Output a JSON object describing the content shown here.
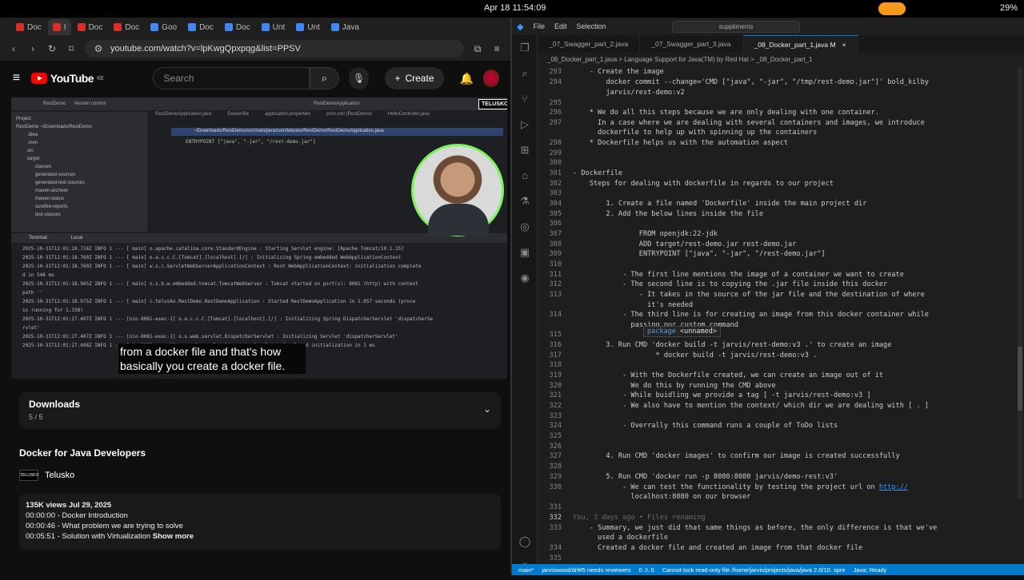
{
  "system": {
    "time": "Apr 18  11:54:09",
    "battery": "29%"
  },
  "browser": {
    "tabs": [
      {
        "label": "Doc",
        "color": "#d93025"
      },
      {
        "label": "I",
        "color": "#d93025"
      },
      {
        "label": "Doc",
        "color": "#d93025"
      },
      {
        "label": "Doc",
        "color": "#d93025"
      },
      {
        "label": "Goo",
        "color": "#4285f4"
      },
      {
        "label": "Doc",
        "color": "#4285f4"
      },
      {
        "label": "Doc",
        "color": "#4285f4"
      },
      {
        "label": "Unt",
        "color": "#4285f4"
      },
      {
        "label": "Unt",
        "color": "#4285f4"
      },
      {
        "label": "Java",
        "color": "#4285f4"
      }
    ],
    "url": "youtube.com/watch?v=lpKwgQpxpqg&list=PPSV"
  },
  "youtube": {
    "logo": "YouTube",
    "country": "KE",
    "search_placeholder": "Search",
    "create": "Create",
    "downloads_title": "Downloads",
    "downloads_count": "5 / 5",
    "video_title": "Docker for Java Developers",
    "channel": "Telusko",
    "channel_logo": "TELUSKO",
    "meta": "135K views  Jul 29, 2025",
    "chapters": [
      {
        "t": "00:00:00",
        "d": "Docker Introduction"
      },
      {
        "t": "00:00:46",
        "d": "What problem we are trying to solve"
      },
      {
        "t": "00:05:51",
        "d": "Solution with Virtualization"
      }
    ],
    "show_more": "Show more",
    "caption_1": "from a docker file and that's how",
    "caption_2": "basically you create a docker file.",
    "badge": "TELUSKO"
  },
  "video_ide": {
    "project": "RestDemo",
    "vcs": "Version control",
    "run_config": "RestDemoApplication",
    "tabs": [
      "RestDemoApplication.java",
      "Dockerfile",
      "application.properties",
      "pom.xml (RestDemo)",
      "HelloController.java"
    ],
    "tree": [
      "Project",
      "RestDemo ~/Downloads/RestDemo",
      ".idea",
      ".mvn",
      "src",
      "target",
      "classes",
      "generated-sources",
      "generated-test-sources",
      "maven-archiver",
      "maven-status",
      "surefire-reports",
      "test-classes"
    ],
    "path_hint": "~/Downloads/RestDemo/src/main/java/com/telusko/RestDemo/RestDemoApplication.java",
    "entrypoint": "ENTRYPOINT [\"java\", \"-jar\", \"/rest-demo.jar\"]",
    "terminal_tabs": [
      "Terminal",
      "Local"
    ],
    "log": [
      "2025-10-31T12:01:18.718Z  INFO 1 --- [   main] o.apache.catalina.core.StandardEngine   : Starting Servlet engine: [Apache Tomcat/10.1.15]",
      "2025-10-31T12:01:18.760Z  INFO 1 --- [   main] o.a.c.c.C.[Tomcat].[localhost].[/]      : Initializing Spring embedded WebApplicationContext",
      "2025-10-31T12:01:18.760Z  INFO 1 --- [   main] w.s.c.ServletWebServerApplicationContext : Root WebApplicationContext: initialization complete",
      "d in 548 ms",
      "2025-10-31T12:01:18.965Z  INFO 1 --- [   main] o.s.b.w.embedded.tomcat.TomcatWebServer  : Tomcat started on port(s): 8081 (http) with context",
      " path ''",
      "2025-10-31T12:01:18.975Z  INFO 1 --- [   main] c.telusko.RestDemo.RestDemoApplication   : Started RestDemoApplication in 1.057 seconds (proce",
      "ss running for 1.338)",
      "2025-10-31T12:01:27.407Z  INFO 1 --- [nio-8081-exec-1] o.a.c.c.C.[Tomcat].[localhost].[/]  : Initializing Spring DispatcherServlet 'dispatcherSe",
      "rvlet'",
      "2025-10-31T12:01:27.407Z  INFO 1 --- [nio-8081-exec-1] o.s.web.servlet.DispatcherServlet   : Initializing Servlet 'dispatcherServlet'",
      "2025-10-31T12:01:27.408Z  INFO 1 --- [nio-8081-exec-1] o.s.web.servlet.DispatcherServlet   : Completed initialization in 1 ms"
    ]
  },
  "vscode": {
    "menu": [
      "File",
      "Edit",
      "Selection"
    ],
    "search": "suppliments",
    "tabs": [
      {
        "label": "_07_Swagger_part_2.java",
        "active": false
      },
      {
        "label": "_07_Swagger_part_3.java",
        "active": false
      },
      {
        "label": "_08_Docker_part_1.java M",
        "active": true
      }
    ],
    "breadcrumb": "_08_Docker_part_1.java  >  Language Support for Java(TM) by Red Hat  >  _08_Docker_part_1",
    "hover": {
      "kw": "package",
      "name": "<unnamed>"
    },
    "status": [
      "main*",
      "jarviswood/drf#5 needs reviewers",
      "0 ⚠ 0",
      "Cannot lock read-only file /home/jarvis/projects/java/java 2.0/10. sprir",
      "Java: Ready"
    ],
    "lines": [
      {
        "n": "293",
        "t": "    - Create the image"
      },
      {
        "n": "294",
        "t": "        docker commit --change='CMD [\"java\", \"-jar\", \"/tmp/rest-demo.jar\"]' bold_kilby"
      },
      {
        "n": "",
        "t": "        jarvis/rest-demo:v2"
      },
      {
        "n": "295",
        "t": ""
      },
      {
        "n": "296",
        "t": "    * We do all this steps because we are only dealing with one container."
      },
      {
        "n": "297",
        "t": "      In a case where we are dealing with several containers and images, we introduce"
      },
      {
        "n": "",
        "t": "      dockerfile to help up with spinning up the containers"
      },
      {
        "n": "298",
        "t": "    * Dockerfile helps us with the automation aspect"
      },
      {
        "n": "299",
        "t": ""
      },
      {
        "n": "300",
        "t": ""
      },
      {
        "n": "301",
        "t": "- Dockerfile"
      },
      {
        "n": "302",
        "t": "    Steps for dealing with dockerfile in regards to our project"
      },
      {
        "n": "303",
        "t": ""
      },
      {
        "n": "304",
        "t": "        1. Create a file named 'Dockerfile' inside the main project dir"
      },
      {
        "n": "305",
        "t": "        2. Add the below lines inside the file"
      },
      {
        "n": "306",
        "t": ""
      },
      {
        "n": "307",
        "t": "                FROM openjdk:22-jdk"
      },
      {
        "n": "308",
        "t": "                ADD target/rest-demo.jar rest-demo.jar"
      },
      {
        "n": "309",
        "t": "                ENTRYPOINT [\"java\", \"-jar\", \"/rest-demo.jar\"]"
      },
      {
        "n": "310",
        "t": ""
      },
      {
        "n": "311",
        "t": "            - The first line mentions the image of a container we want to create"
      },
      {
        "n": "312",
        "t": "            - The second line is to copying the .jar file inside this docker"
      },
      {
        "n": "313",
        "t": "                - It takes in the source of the jar file and the destination of where"
      },
      {
        "n": "",
        "t": "                  it's needed"
      },
      {
        "n": "314",
        "t": "            - The third line is for creating an image from this docker container while"
      },
      {
        "n": "",
        "t": "              passing our custom command"
      },
      {
        "n": "315",
        "t": ""
      },
      {
        "n": "316",
        "t": "        3. Run CMD 'docker build -t jarvis/rest-demo:v3 .' to create an image"
      },
      {
        "n": "317",
        "t": "                    * docker build -t jarvis/rest-demo:v3 ."
      },
      {
        "n": "318",
        "t": ""
      },
      {
        "n": "319",
        "t": "            - With the Dockerfile created, we can create an image out of it"
      },
      {
        "n": "320",
        "t": "              We do this by running the CMD above"
      },
      {
        "n": "321",
        "t": "            - While buidling we provide a tag [ -t jarvis/rest-demo:v3 ]"
      },
      {
        "n": "322",
        "t": "            - We also have to mention the context/ which dir we are dealing with [ . ]"
      },
      {
        "n": "323",
        "t": ""
      },
      {
        "n": "324",
        "t": "            - Overrally this command runs a couple of ToDo lists"
      },
      {
        "n": "325",
        "t": ""
      },
      {
        "n": "326",
        "t": ""
      },
      {
        "n": "327",
        "t": "        4. Run CMD 'docker images' to confirm our image is created successfully"
      },
      {
        "n": "328",
        "t": ""
      },
      {
        "n": "329",
        "t": "        5. Run CMD 'docker run -p 8080:8080 jarvis/demo-rest:v3'"
      },
      {
        "n": "330",
        "t": "            - We can test the functionality by testing the project url on "
      },
      {
        "n": "",
        "t": "              localhost:8080 on our browser"
      },
      {
        "n": "331",
        "t": ""
      },
      {
        "n": "332",
        "t": "You, 3 days ago • Files renaming"
      },
      {
        "n": "333",
        "t": "    - Summary, we just did that same things as before, the only difference is that we've"
      },
      {
        "n": "",
        "t": "      used a dockerfile"
      },
      {
        "n": "334",
        "t": "      Created a docker file and created an image from that docker file"
      },
      {
        "n": "335",
        "t": ""
      }
    ],
    "url_text": "http://"
  }
}
